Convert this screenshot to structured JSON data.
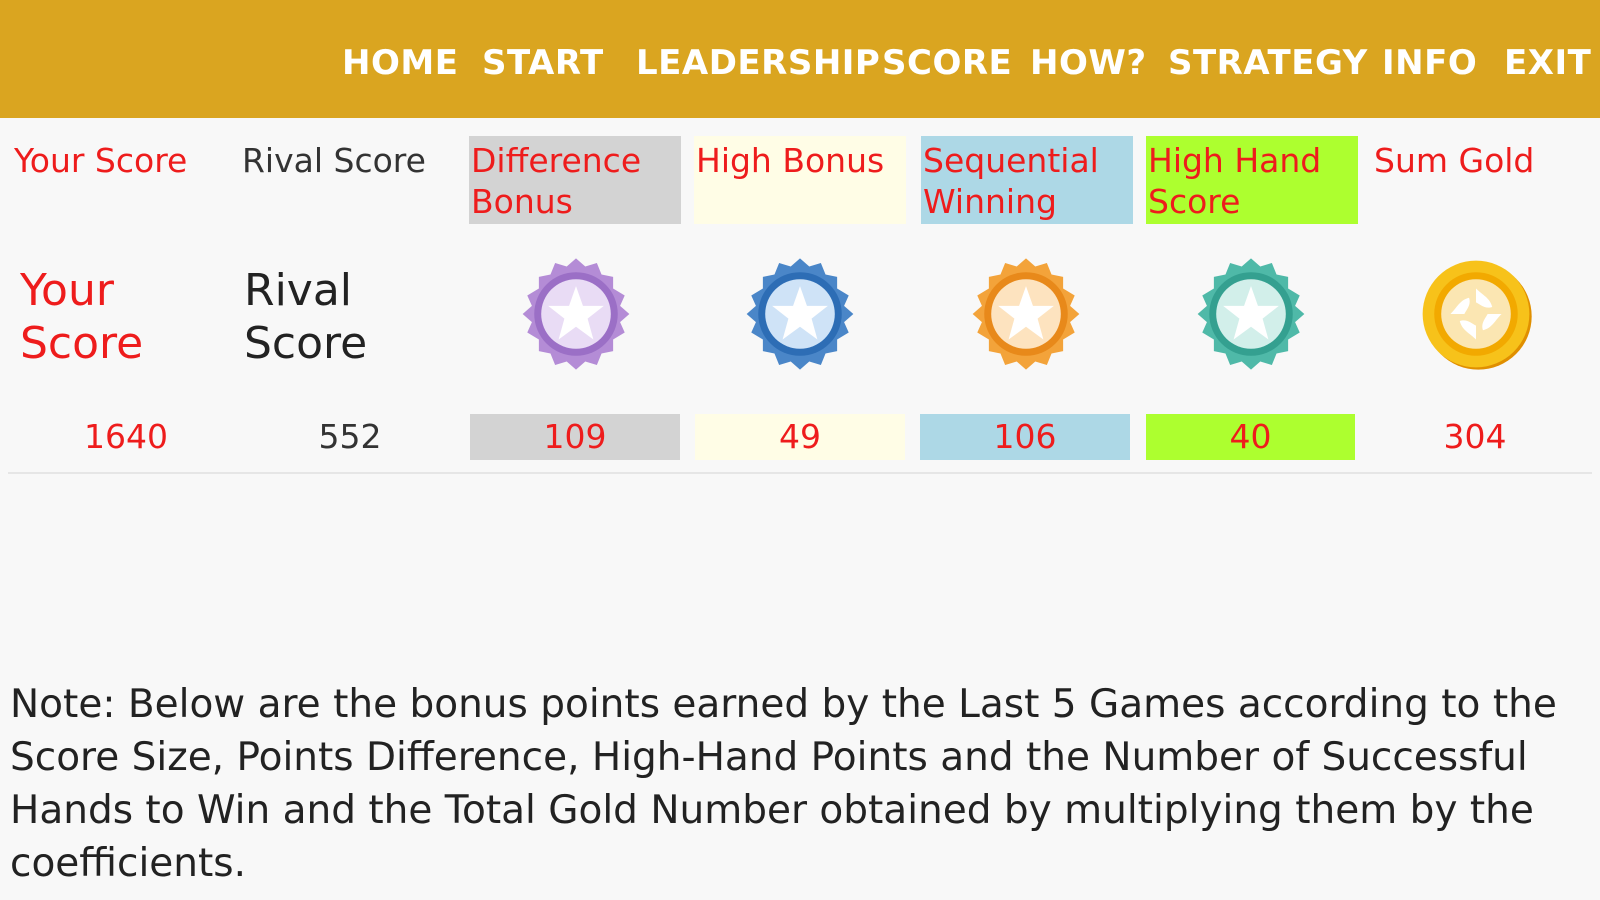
{
  "nav": {
    "home": "HOME",
    "start": "START",
    "leadership": "LEADERSHIP",
    "score": "SCORE",
    "how": "HOW?",
    "strategy": "STRATEGY",
    "info": "INFO",
    "exit": "EXIT"
  },
  "headers": {
    "your_score": "Your Score",
    "rival_score": "Rival Score",
    "difference_bonus": "Difference Bonus",
    "high_bonus": "High Bonus",
    "sequential_winning": "Sequential Winning",
    "high_hand_score": "High Hand Score",
    "sum_gold": "Sum Gold"
  },
  "labels": {
    "your_score": "Your Score",
    "rival_score": "Rival Score"
  },
  "icons": {
    "difference_bonus": "purple-star-badge-icon",
    "high_bonus": "blue-star-badge-icon",
    "sequential_winning": "orange-star-badge-icon",
    "high_hand_score": "teal-star-badge-icon",
    "sum_gold": "gold-coin-icon"
  },
  "values": {
    "your_score": "1640",
    "rival_score": "552",
    "difference_bonus": "109",
    "high_bonus": "49",
    "sequential_winning": "106",
    "high_hand_score": "40",
    "sum_gold": "304"
  },
  "colors": {
    "topbar": "#daa520",
    "accent_text": "#ee1c1c",
    "difference_bonus_bg": "#d3d3d3",
    "high_bonus_bg": "#fffde6",
    "sequential_winning_bg": "#add8e6",
    "high_hand_score_bg": "#adff2f"
  },
  "note": "Note: Below are the bonus points earned by the Last 5 Games according to the Score Size, Points Difference, High-Hand Points and the Number of Successful Hands to Win and the Total Gold Number obtained by multiplying them by the coefficients."
}
